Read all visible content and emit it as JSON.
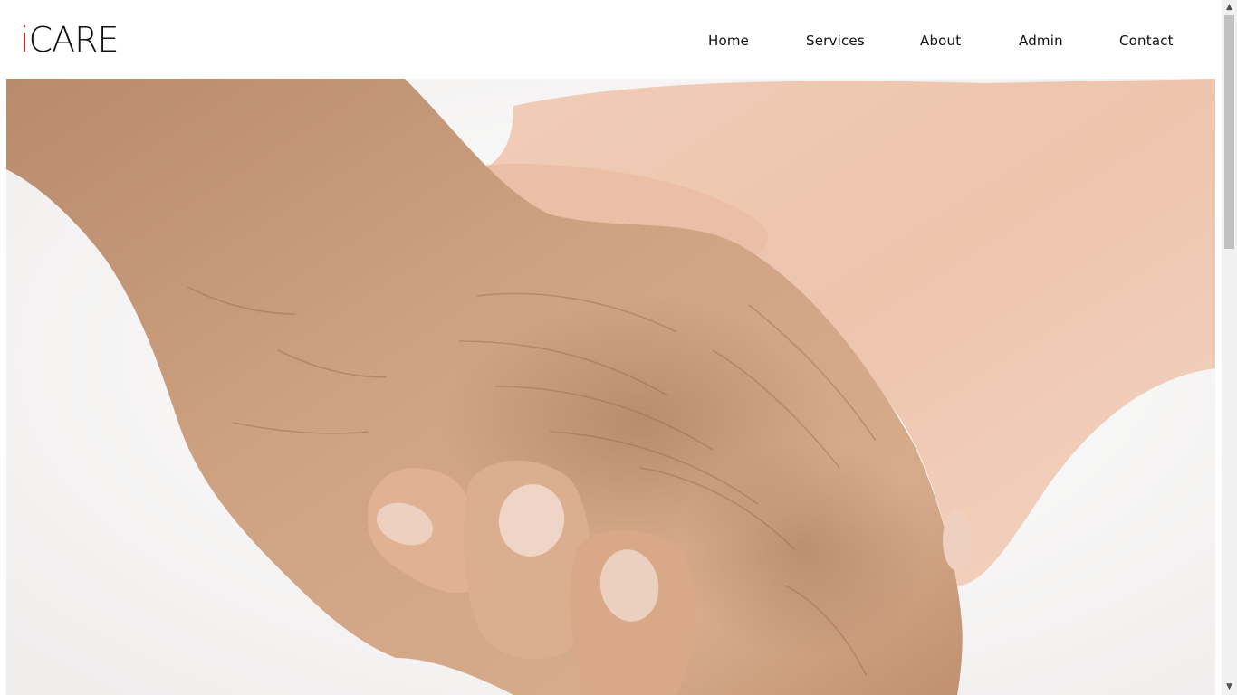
{
  "brand": {
    "logo_prefix": "i",
    "logo_rest": "CARE",
    "prefix_color": "#e0201b"
  },
  "nav": {
    "items": [
      {
        "label": "Home"
      },
      {
        "label": "Services"
      },
      {
        "label": "About"
      },
      {
        "label": "Admin"
      },
      {
        "label": "Contact"
      }
    ]
  },
  "hero": {
    "image_subject": "elderly hand held by younger hand",
    "background_color": "#f6f5f3"
  },
  "scrollbar": {
    "up_icon": "triangle-up-icon",
    "down_icon": "triangle-down-icon"
  }
}
